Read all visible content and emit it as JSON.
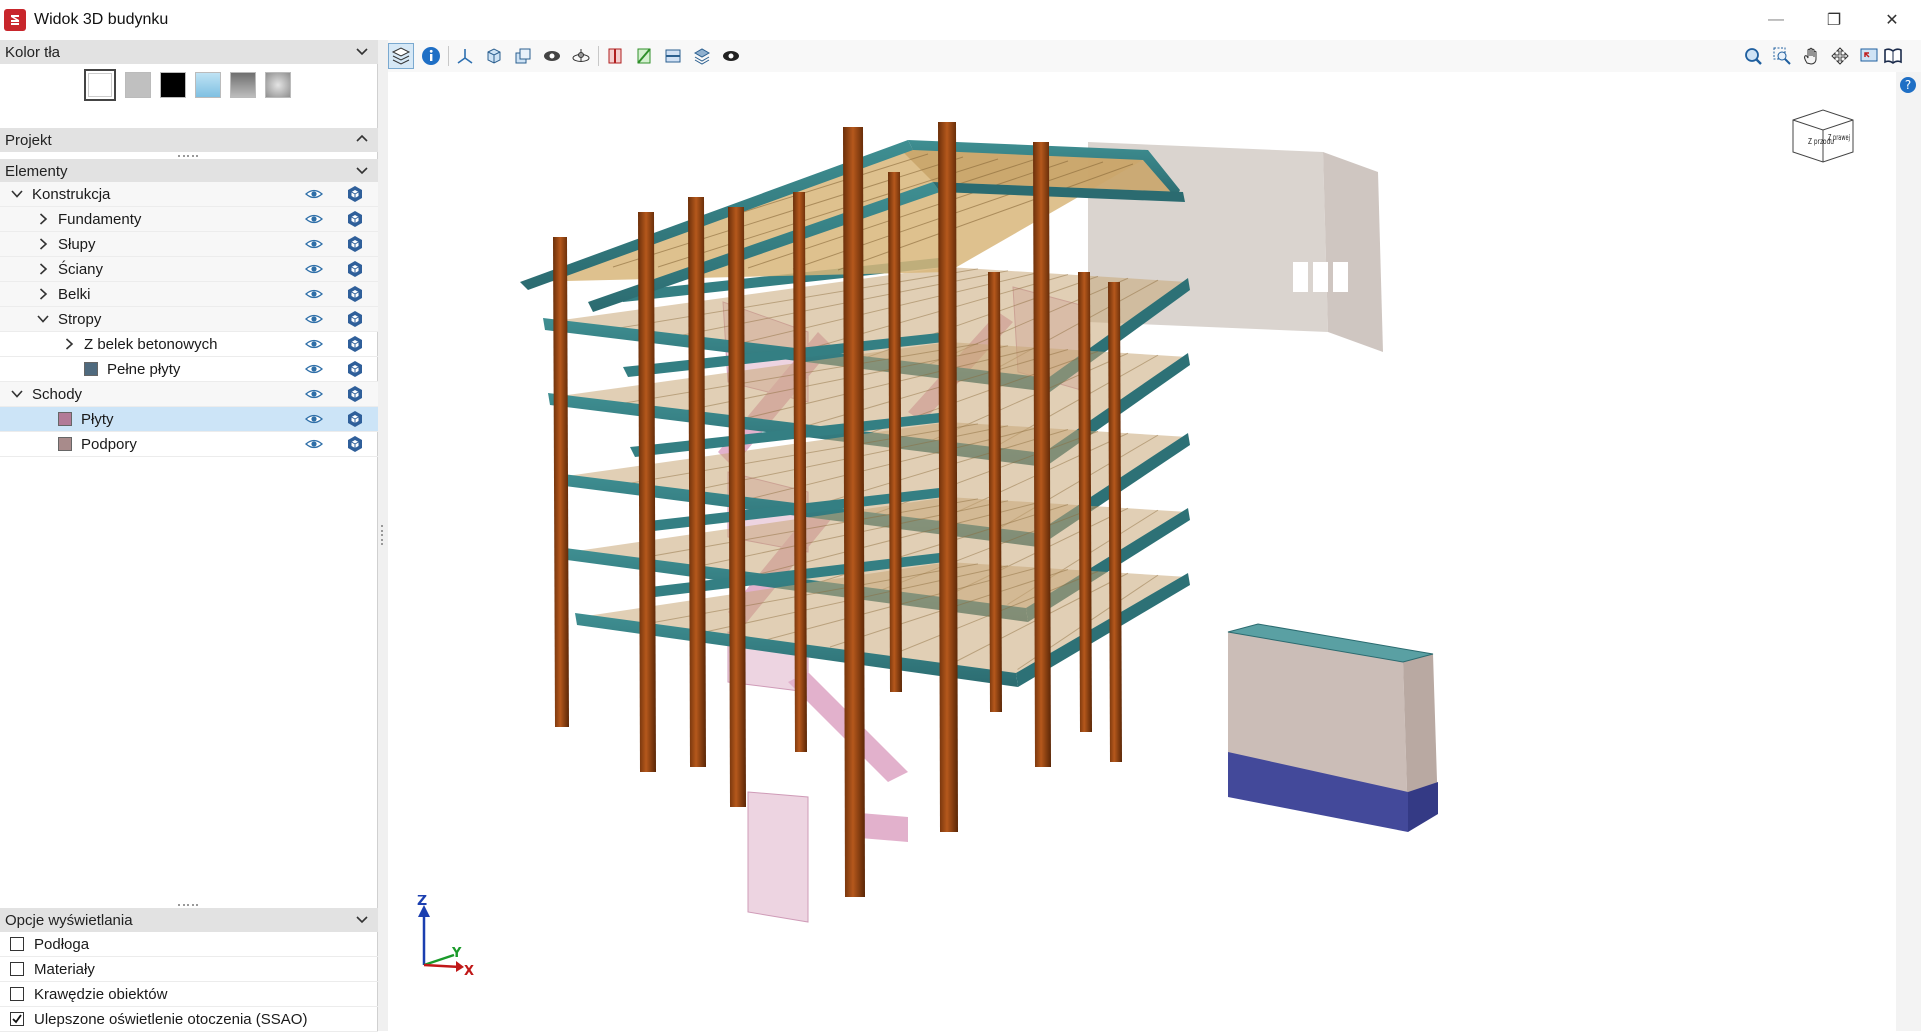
{
  "window": {
    "title": "Widok 3D budynku",
    "minimize": "—",
    "restore": "❐",
    "close": "✕"
  },
  "panels": {
    "background": {
      "header": "Kolor tła"
    },
    "project": {
      "header": "Projekt"
    },
    "elements": {
      "header": "Elementy"
    },
    "display_options": {
      "header": "Opcje wyświetlania"
    }
  },
  "swatches": [
    {
      "name": "white",
      "color": "#ffffff"
    },
    {
      "name": "light-gray",
      "color": "#c0c0c0"
    },
    {
      "name": "black",
      "color": "#000000"
    },
    {
      "name": "light-blue",
      "color": "#8fcbe8"
    },
    {
      "name": "gray-gradient",
      "color": "#8f8f8f"
    },
    {
      "name": "silver-gradient",
      "color": "#b9b9b9"
    }
  ],
  "tree": [
    {
      "label": "Konstrukcja",
      "level": 0,
      "expander": "open"
    },
    {
      "label": "Fundamenty",
      "level": 1,
      "expander": "closed"
    },
    {
      "label": "Słupy",
      "level": 1,
      "expander": "closed"
    },
    {
      "label": "Ściany",
      "level": 1,
      "expander": "closed"
    },
    {
      "label": "Belki",
      "level": 1,
      "expander": "closed"
    },
    {
      "label": "Stropy",
      "level": 1,
      "expander": "open"
    },
    {
      "label": "Z belek betonowych",
      "level": 2,
      "expander": "closed"
    },
    {
      "label": "Pełne płyty",
      "level": 2,
      "expander": "none",
      "color": "#4f6a7e"
    },
    {
      "label": "Schody",
      "level": 0,
      "expander": "open"
    },
    {
      "label": "Płyty",
      "level": 1,
      "expander": "none",
      "color": "#b27a97",
      "selected": true
    },
    {
      "label": "Podpory",
      "level": 1,
      "expander": "none",
      "color": "#a88b8b"
    }
  ],
  "options": [
    {
      "label": "Podłoga",
      "checked": false
    },
    {
      "label": "Materiały",
      "checked": false
    },
    {
      "label": "Krawędzie obiektów",
      "checked": false
    },
    {
      "label": "Ulepszone oświetlenie otoczenia (SSAO)",
      "checked": true
    }
  ],
  "axes": {
    "z": "Z",
    "y": "Y",
    "x": "X"
  },
  "view_cube": {
    "front": "Z przodu",
    "right": "Z prawej"
  }
}
